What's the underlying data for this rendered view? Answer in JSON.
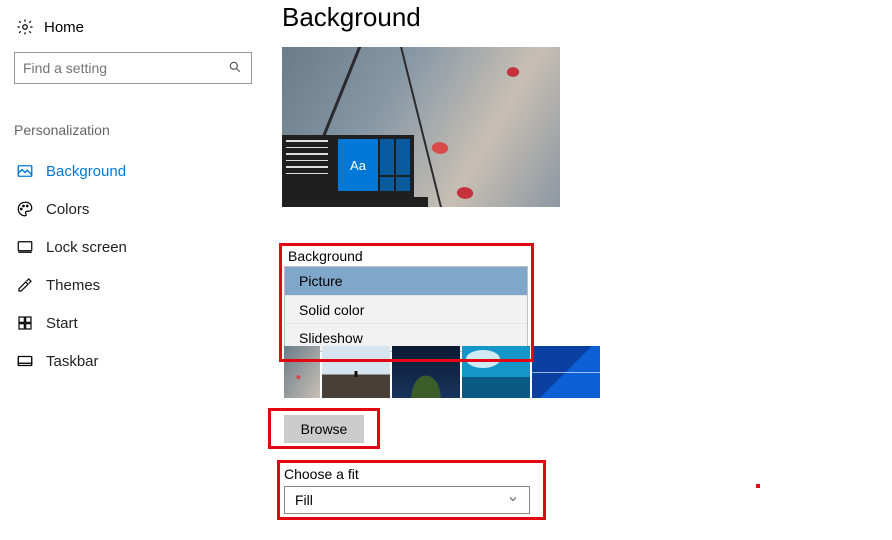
{
  "sidebar": {
    "home": "Home",
    "search_placeholder": "Find a setting",
    "section": "Personalization",
    "items": [
      {
        "label": "Background",
        "icon": "picture-icon",
        "active": true
      },
      {
        "label": "Colors",
        "icon": "palette-icon"
      },
      {
        "label": "Lock screen",
        "icon": "lockscreen-icon"
      },
      {
        "label": "Themes",
        "icon": "themes-icon"
      },
      {
        "label": "Start",
        "icon": "start-icon"
      },
      {
        "label": "Taskbar",
        "icon": "taskbar-icon"
      }
    ]
  },
  "page": {
    "title": "Background",
    "preview_tile_text": "Aa"
  },
  "background_dropdown": {
    "label": "Background",
    "options": [
      "Picture",
      "Solid color",
      "Slideshow"
    ],
    "selected": "Picture"
  },
  "browse_button": "Browse",
  "fit": {
    "label": "Choose a fit",
    "value": "Fill"
  },
  "colors": {
    "accent": "#0078d7",
    "highlight_box": "#e30613",
    "dropdown_selected": "#7fa7c9"
  }
}
